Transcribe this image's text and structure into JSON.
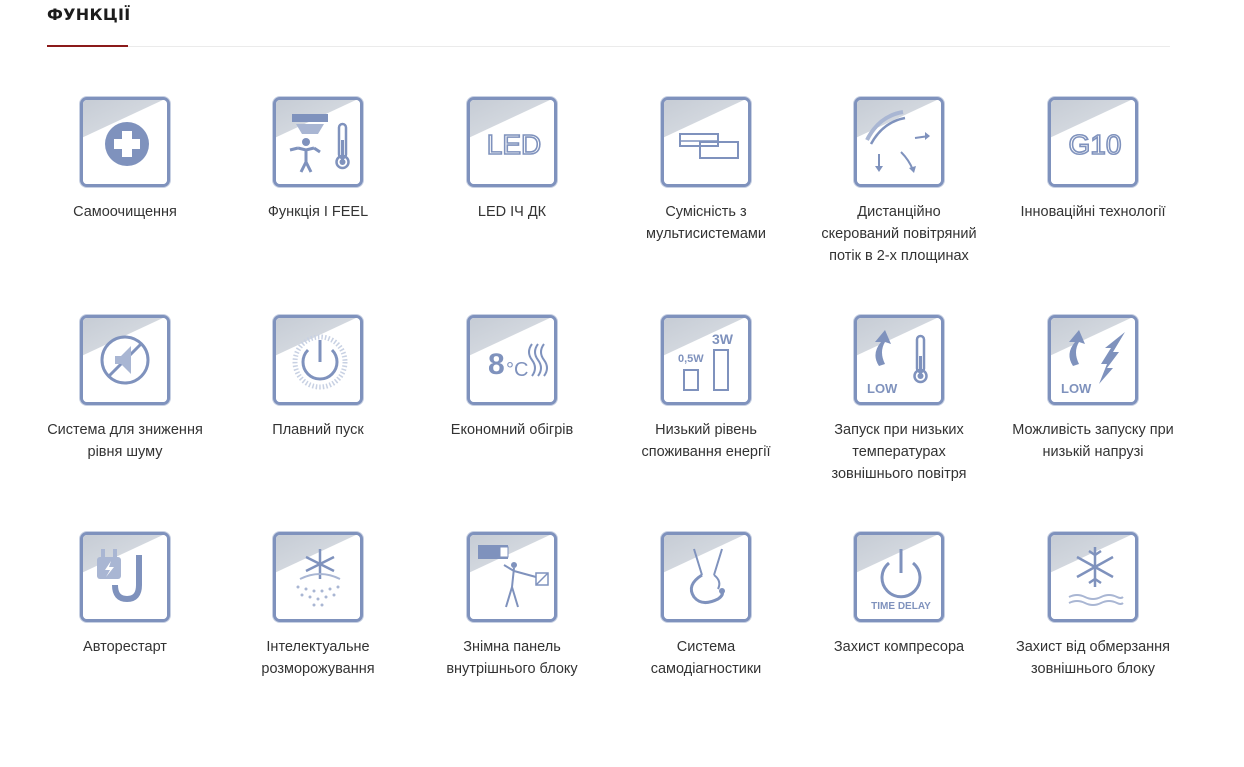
{
  "section": {
    "title": "ФУНКЦІЇ"
  },
  "features": [
    {
      "label": "Самоочищення",
      "icon": "cross-circle-icon"
    },
    {
      "label": "Функція I FEEL",
      "icon": "person-thermometer-icon"
    },
    {
      "label": "LED ІЧ ДК",
      "icon": "led-icon",
      "icon_text": "LED"
    },
    {
      "label": "Сумісність з мультисистемами",
      "icon": "multi-system-icon"
    },
    {
      "label": "Дистанційно скерований повітряний потік в 2-х площинах",
      "icon": "airflow-2d-icon"
    },
    {
      "label": "Інноваційні технології",
      "icon": "g10-icon",
      "icon_text": "G10"
    },
    {
      "label": "Система для зниження рівня шуму",
      "icon": "mute-icon"
    },
    {
      "label": "Плавний пуск",
      "icon": "soft-start-icon"
    },
    {
      "label": "Економний обігрів",
      "icon": "heating-8c-icon",
      "icon_text": "8",
      "icon_text_2": "°C"
    },
    {
      "label": "Низький рівень споживання енергії",
      "icon": "low-power-icon",
      "icon_text": "3W",
      "icon_text_2": "0,5W"
    },
    {
      "label": "Запуск при низьких температурах зовнішнього повітря",
      "icon": "low-temp-start-icon",
      "icon_text": "LOW"
    },
    {
      "label": "Можливість запуску при низькій напрузі",
      "icon": "low-voltage-start-icon",
      "icon_text": "LOW"
    },
    {
      "label": "Авторестарт",
      "icon": "auto-restart-icon"
    },
    {
      "label": "Інтелектуальне розморожування",
      "icon": "smart-defrost-icon"
    },
    {
      "label": "Знімна панель внутрішнього блоку",
      "icon": "removable-panel-icon"
    },
    {
      "label": "Система самодіагностики",
      "icon": "self-diagnostics-icon"
    },
    {
      "label": "Захист компресора",
      "icon": "compressor-protection-icon",
      "icon_text": "TIME DELAY"
    },
    {
      "label": "Захист від обмерзання зовнішнього блоку",
      "icon": "anti-freeze-icon"
    }
  ],
  "colors": {
    "accent": "#8b1a1a",
    "icon_blue": "#7f92bd",
    "tile_grey": "#c6ccd5",
    "text": "#333333"
  }
}
